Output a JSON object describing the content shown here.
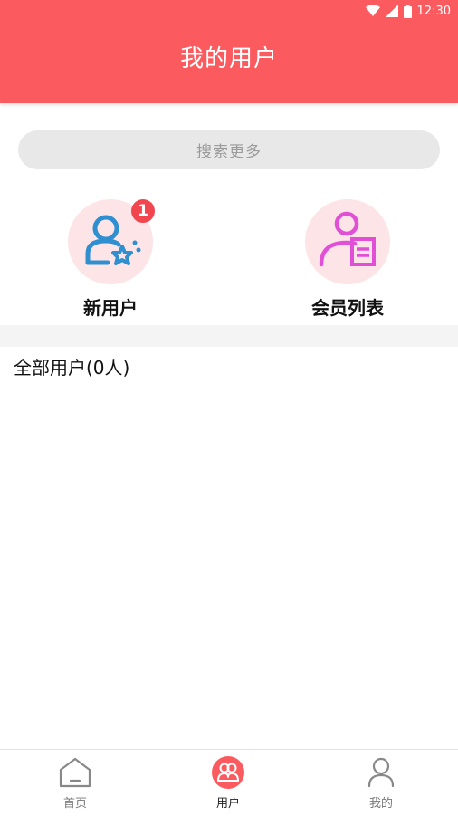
{
  "status_bar": {
    "time": "12:30"
  },
  "header": {
    "title": "我的用户"
  },
  "search": {
    "placeholder": "搜索更多"
  },
  "shortcuts": [
    {
      "label": "新用户",
      "badge": "1",
      "icon": "new-user-icon",
      "color": "#2f8fd0"
    },
    {
      "label": "会员列表",
      "icon": "member-list-icon",
      "color": "#e04fd6"
    }
  ],
  "section": {
    "title": "全部用户(0人)"
  },
  "tabbar": {
    "items": [
      {
        "label": "首页",
        "icon": "home-icon"
      },
      {
        "label": "用户",
        "icon": "users-icon",
        "active": true
      },
      {
        "label": "我的",
        "icon": "profile-icon"
      }
    ]
  },
  "colors": {
    "brand": "#fb5b5f",
    "badge": "#f2464f"
  }
}
